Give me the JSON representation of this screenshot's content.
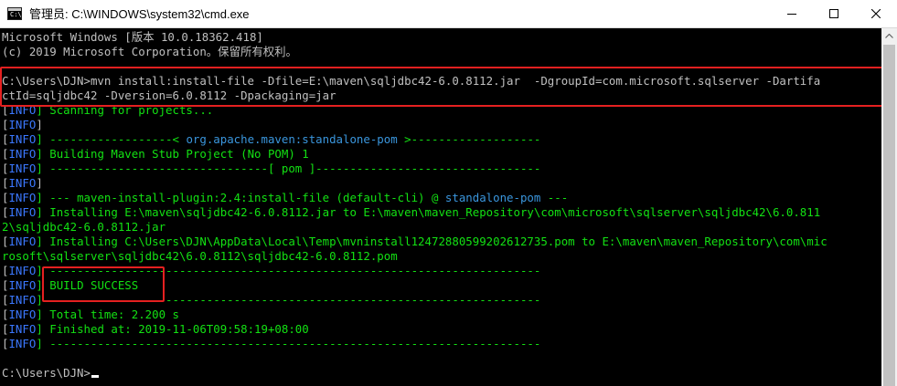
{
  "window": {
    "title": "管理员: C:\\WINDOWS\\system32\\cmd.exe",
    "app_icon_text": "C:\\"
  },
  "console": {
    "lines": [
      {
        "parts": [
          {
            "t": "Microsoft Windows [版本 10.0.18362.418]",
            "c": "gray"
          }
        ]
      },
      {
        "parts": [
          {
            "t": "(c) 2019 Microsoft Corporation。保留所有权利。",
            "c": "gray"
          }
        ]
      },
      {
        "parts": [
          {
            "t": "",
            "c": "gray"
          }
        ]
      },
      {
        "parts": [
          {
            "t": "C:\\Users\\DJN>mvn install:install-file -Dfile=E:\\maven\\sqljdbc42-6.0.8112.jar  -DgroupId=com.microsoft.sqlserver -Dartifa",
            "c": "gray"
          }
        ]
      },
      {
        "parts": [
          {
            "t": "ctId=sqljdbc42 -Dversion=6.0.8112 -Dpackaging=jar",
            "c": "gray"
          }
        ]
      },
      {
        "parts": [
          {
            "t": "[",
            "c": "gray"
          },
          {
            "t": "INFO",
            "c": "blue"
          },
          {
            "t": "] Scanning for projects...",
            "c": "green"
          }
        ]
      },
      {
        "parts": [
          {
            "t": "[",
            "c": "gray"
          },
          {
            "t": "INFO",
            "c": "blue"
          },
          {
            "t": "]",
            "c": "gray"
          }
        ]
      },
      {
        "parts": [
          {
            "t": "[",
            "c": "gray"
          },
          {
            "t": "INFO",
            "c": "blue"
          },
          {
            "t": "] ------------------< ",
            "c": "green"
          },
          {
            "t": "org.apache.maven:standalone-pom",
            "c": "cyan"
          },
          {
            "t": " >-------------------",
            "c": "green"
          }
        ]
      },
      {
        "parts": [
          {
            "t": "[",
            "c": "gray"
          },
          {
            "t": "INFO",
            "c": "blue"
          },
          {
            "t": "] Building Maven Stub Project (No POM) 1",
            "c": "green"
          }
        ]
      },
      {
        "parts": [
          {
            "t": "[",
            "c": "gray"
          },
          {
            "t": "INFO",
            "c": "blue"
          },
          {
            "t": "] --------------------------------[ pom ]---------------------------------",
            "c": "green"
          }
        ]
      },
      {
        "parts": [
          {
            "t": "[",
            "c": "gray"
          },
          {
            "t": "INFO",
            "c": "blue"
          },
          {
            "t": "]",
            "c": "gray"
          }
        ]
      },
      {
        "parts": [
          {
            "t": "[",
            "c": "gray"
          },
          {
            "t": "INFO",
            "c": "blue"
          },
          {
            "t": "] --- maven-install-plugin:2.4:install-file (default-cli) @ ",
            "c": "green"
          },
          {
            "t": "standalone-pom",
            "c": "cyan"
          },
          {
            "t": " ---",
            "c": "green"
          }
        ]
      },
      {
        "parts": [
          {
            "t": "[",
            "c": "gray"
          },
          {
            "t": "INFO",
            "c": "blue"
          },
          {
            "t": "] Installing E:\\maven\\sqljdbc42-6.0.8112.jar to E:\\maven\\maven_Repository\\com\\microsoft\\sqlserver\\sqljdbc42\\6.0.811",
            "c": "green"
          }
        ]
      },
      {
        "parts": [
          {
            "t": "2\\sqljdbc42-6.0.8112.jar",
            "c": "green"
          }
        ]
      },
      {
        "parts": [
          {
            "t": "[",
            "c": "gray"
          },
          {
            "t": "INFO",
            "c": "blue"
          },
          {
            "t": "] Installing C:\\Users\\DJN\\AppData\\Local\\Temp\\mvninstall12472880599202612735.pom to E:\\maven\\maven_Repository\\com\\mic",
            "c": "green"
          }
        ]
      },
      {
        "parts": [
          {
            "t": "rosoft\\sqlserver\\sqljdbc42\\6.0.8112\\sqljdbc42-6.0.8112.pom",
            "c": "green"
          }
        ]
      },
      {
        "parts": [
          {
            "t": "[",
            "c": "gray"
          },
          {
            "t": "INFO",
            "c": "blue"
          },
          {
            "t": "] ------------------------------------------------------------------------",
            "c": "green"
          }
        ]
      },
      {
        "parts": [
          {
            "t": "[",
            "c": "gray"
          },
          {
            "t": "INFO",
            "c": "blue"
          },
          {
            "t": "] BUILD SUCCESS",
            "c": "green"
          }
        ]
      },
      {
        "parts": [
          {
            "t": "[",
            "c": "gray"
          },
          {
            "t": "INFO",
            "c": "blue"
          },
          {
            "t": "] ------------------------------------------------------------------------",
            "c": "green"
          }
        ]
      },
      {
        "parts": [
          {
            "t": "[",
            "c": "gray"
          },
          {
            "t": "INFO",
            "c": "blue"
          },
          {
            "t": "] Total time: 2.200 s",
            "c": "green"
          }
        ]
      },
      {
        "parts": [
          {
            "t": "[",
            "c": "gray"
          },
          {
            "t": "INFO",
            "c": "blue"
          },
          {
            "t": "] Finished at: 2019-11-06T09:58:19+08:00",
            "c": "green"
          }
        ]
      },
      {
        "parts": [
          {
            "t": "[",
            "c": "gray"
          },
          {
            "t": "INFO",
            "c": "blue"
          },
          {
            "t": "] ------------------------------------------------------------------------",
            "c": "green"
          }
        ]
      },
      {
        "parts": [
          {
            "t": "",
            "c": "gray"
          }
        ]
      },
      {
        "parts": [
          {
            "t": "C:\\Users\\DJN>",
            "c": "gray"
          }
        ]
      }
    ]
  },
  "colors": {
    "background": "#000000",
    "text_gray": "#c0c0c0",
    "text_green": "#13e113",
    "info_blue": "#3b78ff",
    "link_cyan": "#3a96dd",
    "highlight_red": "#e52020"
  },
  "icons": {
    "minimize": "minimize-icon",
    "maximize": "maximize-icon",
    "close": "close-icon",
    "scroll_up": "chevron-up-icon"
  }
}
